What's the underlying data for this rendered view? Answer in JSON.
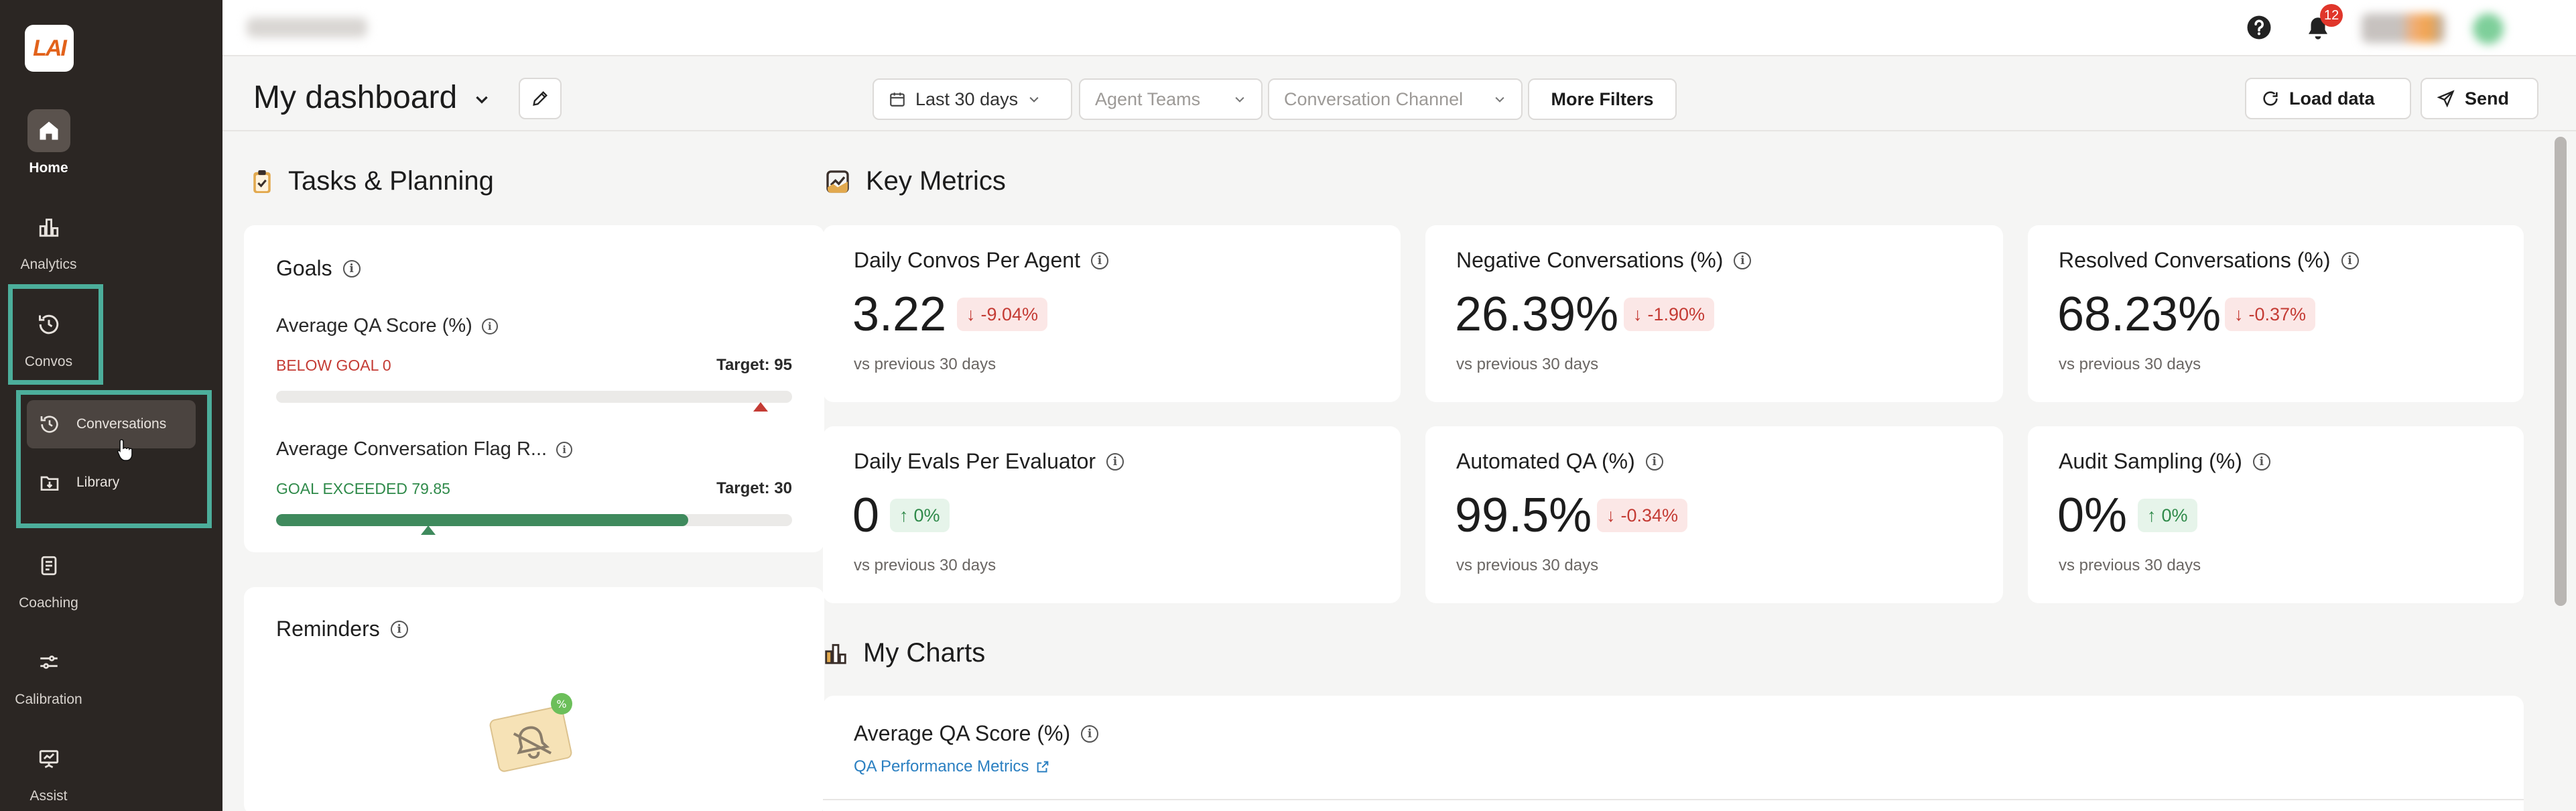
{
  "sidebar": {
    "logo_text": "LAI",
    "items": [
      {
        "label": "Home",
        "icon": "home-icon"
      },
      {
        "label": "Analytics",
        "icon": "bar-chart-icon"
      },
      {
        "label": "Convos",
        "icon": "history-icon"
      },
      {
        "label": "Coaching",
        "icon": "clipboard-icon"
      },
      {
        "label": "Calibration",
        "icon": "sliders-icon"
      },
      {
        "label": "Assist",
        "icon": "presentation-icon"
      }
    ],
    "submenu": [
      {
        "label": "Conversations",
        "icon": "history-icon"
      },
      {
        "label": "Library",
        "icon": "folder-download-icon"
      }
    ]
  },
  "topbar": {
    "notification_count": "12",
    "help_icon": "help-icon",
    "bell_icon": "bell-icon"
  },
  "toolbar": {
    "title": "My dashboard",
    "date_filter": "Last 30 days",
    "agent_teams": "Agent Teams",
    "channel": "Conversation Channel",
    "more_filters": "More Filters",
    "load_data": "Load data",
    "send": "Send"
  },
  "tasks": {
    "heading": "Tasks & Planning",
    "goals_title": "Goals",
    "goals": [
      {
        "name": "Average QA Score (%)",
        "status": "BELOW GOAL 0",
        "target": "Target: 95",
        "progress": 0,
        "status_color": "#c43b34"
      },
      {
        "name": "Average Conversation Flag R...",
        "status": "GOAL EXCEEDED 79.85",
        "target": "Target: 30",
        "progress": 0.799,
        "status_color": "#2f8a4a"
      }
    ],
    "reminders_title": "Reminders"
  },
  "metrics": {
    "heading": "Key Metrics",
    "cards": [
      {
        "title": "Daily Convos Per Agent",
        "value": "3.22",
        "delta": "-9.04%",
        "dir": "down",
        "vs": "vs previous 30 days"
      },
      {
        "title": "Negative Conversations (%)",
        "value": "26.39%",
        "delta": "-1.90%",
        "dir": "down",
        "vs": "vs previous 30 days"
      },
      {
        "title": "Resolved Conversations (%)",
        "value": "68.23%",
        "delta": "-0.37%",
        "dir": "down",
        "vs": "vs previous 30 days"
      },
      {
        "title": "Daily Evals Per Evaluator",
        "value": "0",
        "delta": "0%",
        "dir": "up",
        "vs": "vs previous 30 days"
      },
      {
        "title": "Automated QA (%)",
        "value": "99.5%",
        "delta": "-0.34%",
        "dir": "down",
        "vs": "vs previous 30 days"
      },
      {
        "title": "Audit Sampling (%)",
        "value": "0%",
        "delta": "0%",
        "dir": "up",
        "vs": "vs previous 30 days"
      }
    ]
  },
  "charts": {
    "heading": "My Charts",
    "card_title": "Average QA Score (%)",
    "link": "QA Performance Metrics"
  },
  "colors": {
    "accent_highlight": "#4cae9b",
    "sidebar_bg": "#2b2623",
    "negative": "#c43b34",
    "positive": "#2f8a4a",
    "link": "#2a7fc1"
  }
}
